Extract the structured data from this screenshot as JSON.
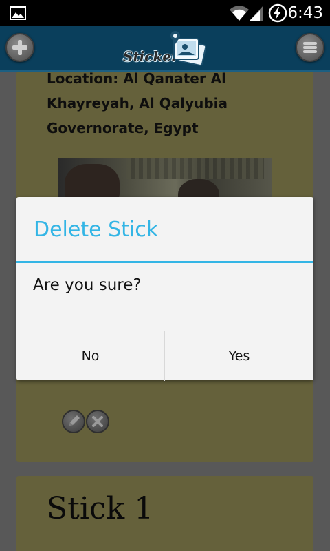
{
  "status_bar": {
    "time": "6:43",
    "icons": [
      "gallery-icon",
      "wifi-icon",
      "signal-icon",
      "battery-charging-icon"
    ]
  },
  "app_bar": {
    "logo_text": "Sticker",
    "add_icon": "plus-icon",
    "menu_icon": "menu-lines-icon",
    "colors": {
      "bar": "#0a3f5c",
      "accent_line": "#1c5f82"
    }
  },
  "cards": [
    {
      "location_text": "Location: Al Qanater Al Khayreyah, Al Qalyubia Governorate, Egypt",
      "edit_icon": "pencil-icon",
      "delete_icon": "close-icon"
    },
    {
      "title": "Stick 1"
    }
  ],
  "dialog": {
    "title": "Delete Stick",
    "message": "Are you sure?",
    "negative_label": "No",
    "positive_label": "Yes",
    "accent_color": "#33b5e5"
  }
}
